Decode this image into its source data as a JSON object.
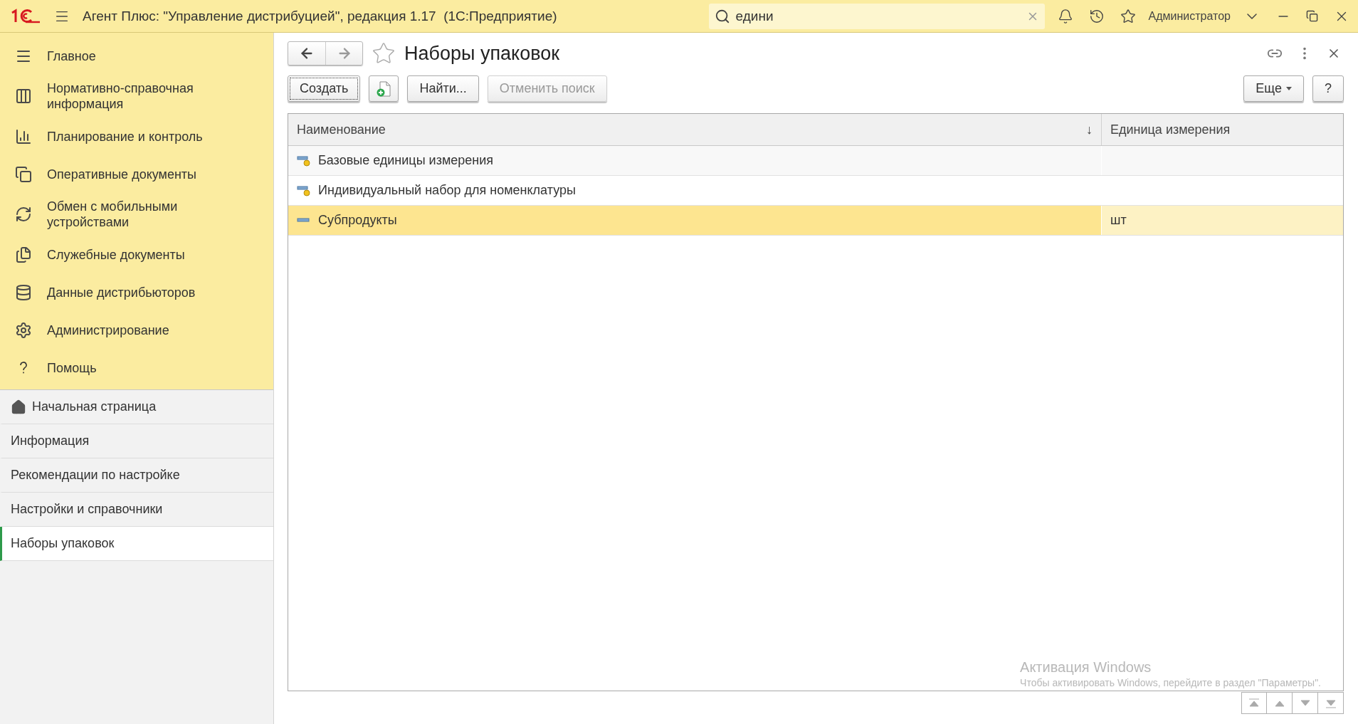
{
  "app_bar": {
    "title": "Агент Плюс: \"Управление дистрибуцией\", редакция 1.17  (1С:Предприятие)",
    "search": {
      "value": "едини"
    },
    "user": "Администратор"
  },
  "sections": [
    {
      "label": "Главное"
    },
    {
      "label": "Нормативно-справочная информация"
    },
    {
      "label": "Планирование и контроль"
    },
    {
      "label": "Оперативные документы"
    },
    {
      "label": "Обмен с мобильными устройствами"
    },
    {
      "label": "Служебные документы"
    },
    {
      "label": "Данные дистрибьюторов"
    },
    {
      "label": "Администрирование"
    },
    {
      "label": "Помощь"
    }
  ],
  "open_windows": [
    {
      "label": "Начальная страница",
      "kind": "home",
      "selected": false
    },
    {
      "label": "Информация",
      "kind": "page",
      "selected": false
    },
    {
      "label": "Рекомендации по настройке",
      "kind": "page",
      "selected": false
    },
    {
      "label": "Настройки и справочники",
      "kind": "page",
      "selected": false
    },
    {
      "label": "Наборы упаковок",
      "kind": "page",
      "selected": true
    }
  ],
  "form": {
    "title": "Наборы упаковок",
    "favorite": false,
    "toolbar": [
      {
        "label": "Создать",
        "kind": "text",
        "disabled": false
      },
      {
        "kind": "create-copy",
        "disabled": false
      },
      {
        "label": "Найти...",
        "kind": "text",
        "disabled": false
      },
      {
        "label": "Отменить поиск",
        "kind": "text",
        "disabled": true
      }
    ],
    "more_button": "Еще",
    "help_button": "?",
    "table": {
      "columns": [
        {
          "label": "Наименование",
          "sort": "↓"
        },
        {
          "label": "Единица измерения"
        }
      ],
      "rows": [
        {
          "kind": "group",
          "name": "Базовые единицы измерения",
          "unit": "",
          "selected": false
        },
        {
          "kind": "group",
          "name": "Индивидуальный набор для номенклатуры",
          "unit": "",
          "selected": false
        },
        {
          "kind": "item",
          "name": "Субпродукты",
          "unit": "шт",
          "selected": true
        }
      ]
    }
  },
  "os_notice": {
    "title": "Активация Windows",
    "text": "Чтобы активировать Windows, перейдите в раздел \"Параметры\"."
  }
}
